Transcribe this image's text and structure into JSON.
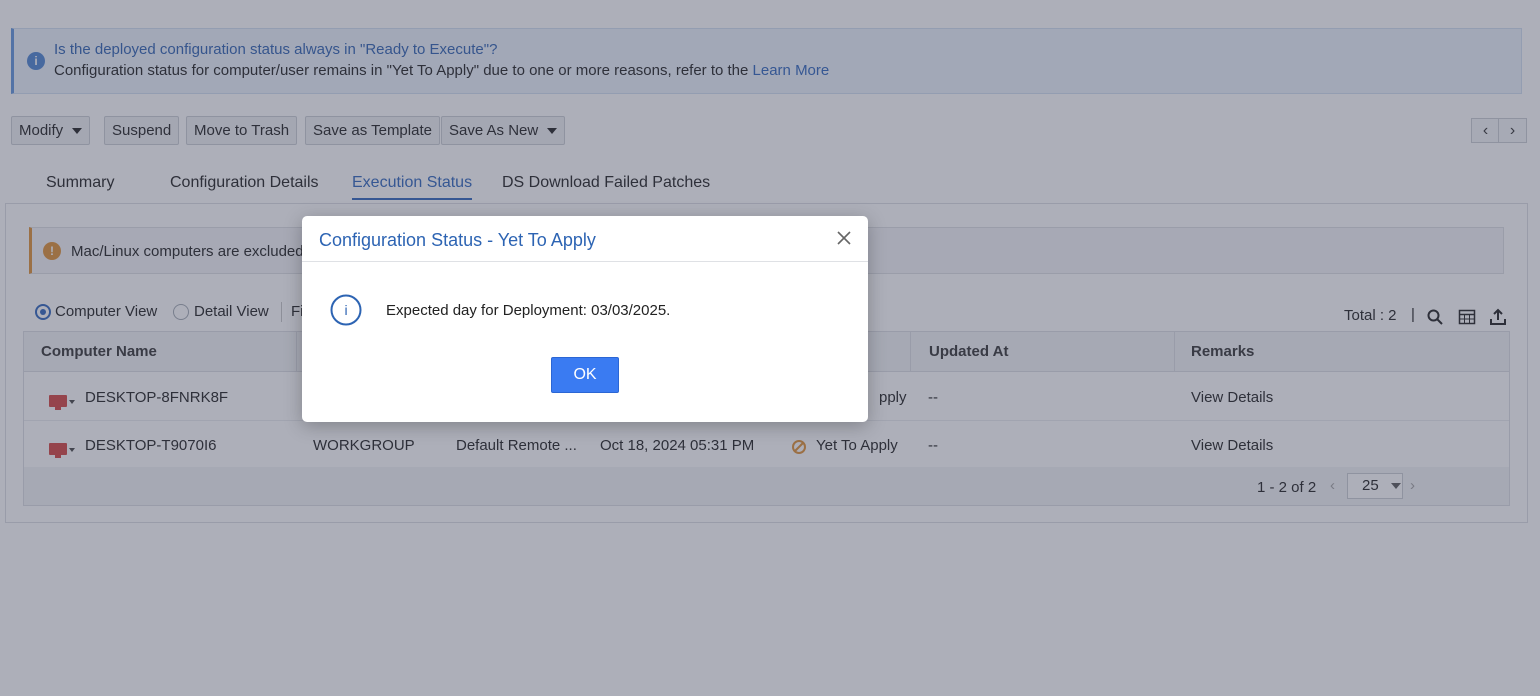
{
  "info_banner": {
    "question": "Is the deployed configuration status always in \"Ready to Execute\"?",
    "description": "Configuration status for computer/user remains in \"Yet To Apply\" due to one or more reasons, refer to the",
    "link": "Learn More"
  },
  "toolbar": {
    "modify": "Modify",
    "suspend": "Suspend",
    "move_to_trash": "Move to Trash",
    "save_as_template": "Save as Template",
    "save_as_new": "Save As New",
    "prev": "‹",
    "next": "›"
  },
  "tabs": [
    {
      "label": "Summary"
    },
    {
      "label": "Configuration Details"
    },
    {
      "label": "Execution Status"
    },
    {
      "label": "DS Download Failed Patches"
    }
  ],
  "warning": {
    "text": "Mac/Linux computers are excluded f"
  },
  "views": {
    "computer_view": "Computer View",
    "detail_view": "Detail View",
    "filter_partial": "Fi"
  },
  "total_label": "Total : 2",
  "separator": "|",
  "table": {
    "headers": {
      "computer_name": "Computer Name",
      "updated_at": "Updated At",
      "remarks": "Remarks"
    },
    "rows": [
      {
        "computer": "DESKTOP-8FNRK8F",
        "domain": "",
        "config": "",
        "time": "",
        "status": "pply",
        "updated": "--",
        "remarks": "View Details"
      },
      {
        "computer": "DESKTOP-T9070I6",
        "domain": "WORKGROUP",
        "config": "Default Remote ...",
        "time": "Oct 18, 2024 05:31 PM",
        "status": "Yet To Apply",
        "updated": "--",
        "remarks": "View Details"
      }
    ]
  },
  "pager": {
    "range": "1 - 2 of 2",
    "page_size": "25",
    "prev": "‹",
    "next": "›"
  },
  "modal": {
    "title": "Configuration Status - Yet To Apply",
    "message": "Expected day for Deployment: 03/03/2025.",
    "ok": "OK",
    "info_glyph": "i"
  },
  "colors": {
    "accent": "#3f72c2",
    "ok_button": "#3a7bf2",
    "warning": "#e39a45",
    "computer_icon": "#d9534f"
  }
}
